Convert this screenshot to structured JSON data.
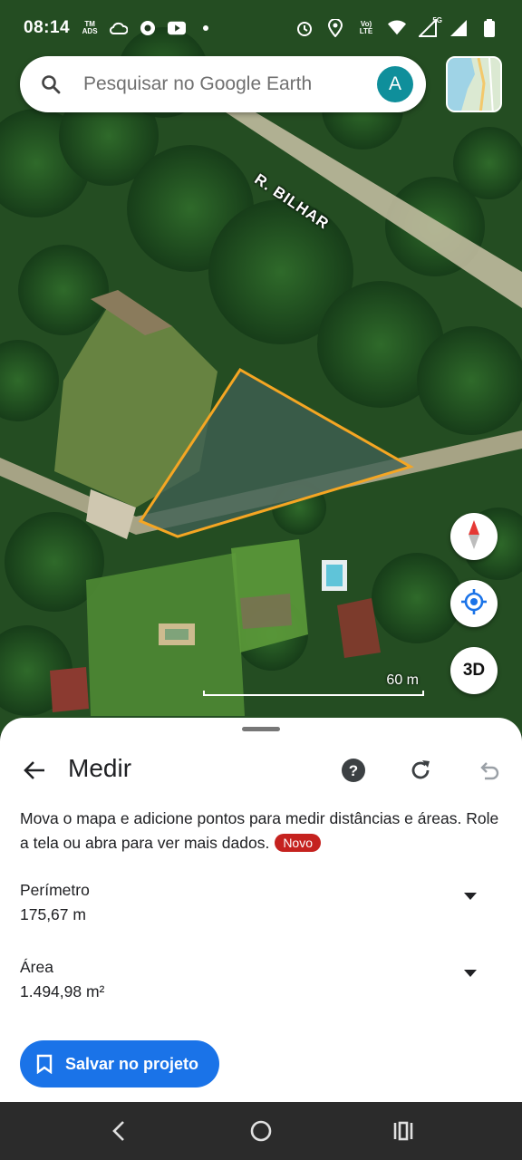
{
  "status_bar": {
    "time": "08:14",
    "net_badge_top": "TM",
    "net_badge_bottom": "ADS",
    "volte_top": "Vo)",
    "volte_bottom": "LTE",
    "signal_label": "5G"
  },
  "search": {
    "placeholder": "Pesquisar no Google Earth",
    "avatar_letter": "A"
  },
  "map": {
    "road_label": "R. BILHAR",
    "scale_label": "60 m",
    "button_3d": "3D",
    "polygon_color": "#f5a623"
  },
  "measure_sheet": {
    "title": "Medir",
    "description": "Mova o mapa e adicione pontos para medir distâncias e áreas. Role a tela ou abra para ver mais dados.",
    "new_badge": "Novo",
    "perimeter_label": "Perímetro",
    "perimeter_value": "175,67 m",
    "area_label": "Área",
    "area_value": "1.494,98 m²",
    "save_button": "Salvar no projeto"
  },
  "colors": {
    "accent": "#1a73e8",
    "badge": "#c5221f",
    "avatar": "#0f8f9b"
  },
  "icons": {
    "search": "search-icon",
    "back": "back-arrow-icon",
    "help": "help-icon",
    "refresh": "refresh-icon",
    "undo": "undo-icon",
    "compass": "compass-icon",
    "locate": "my-location-icon",
    "save": "bookmark-icon",
    "dropdown": "caret-down-icon"
  }
}
